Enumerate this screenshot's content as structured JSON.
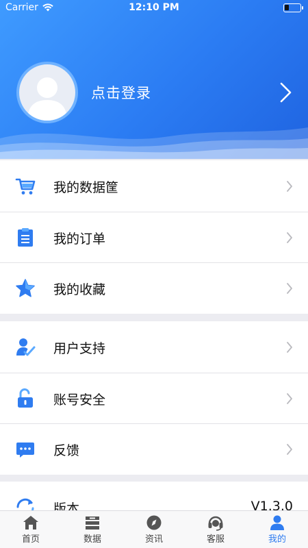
{
  "status_bar": {
    "carrier": "Carrier",
    "time": "12:10 PM"
  },
  "profile": {
    "login_label": "点击登录"
  },
  "menu_group_1": [
    {
      "label": "我的数据筐",
      "icon": "cart-icon"
    },
    {
      "label": "我的订单",
      "icon": "clipboard-icon"
    },
    {
      "label": "我的收藏",
      "icon": "star-icon"
    }
  ],
  "menu_group_2": [
    {
      "label": "用户支持",
      "icon": "user-check-icon"
    },
    {
      "label": "账号安全",
      "icon": "unlock-icon"
    },
    {
      "label": "反馈",
      "icon": "chat-bubble-icon"
    }
  ],
  "menu_group_3": [
    {
      "label": "版本",
      "value": "V1.3.0",
      "icon": "refresh-icon"
    }
  ],
  "tabbar": [
    {
      "label": "首页",
      "icon": "home-icon",
      "active": false
    },
    {
      "label": "数据",
      "icon": "database-icon",
      "active": false
    },
    {
      "label": "资讯",
      "icon": "compass-icon",
      "active": false
    },
    {
      "label": "客服",
      "icon": "headset-icon",
      "active": false
    },
    {
      "label": "我的",
      "icon": "person-icon",
      "active": true
    }
  ],
  "colors": {
    "accent": "#2f7cf0",
    "header_start": "#3f9bff",
    "header_end": "#1f63e0"
  }
}
